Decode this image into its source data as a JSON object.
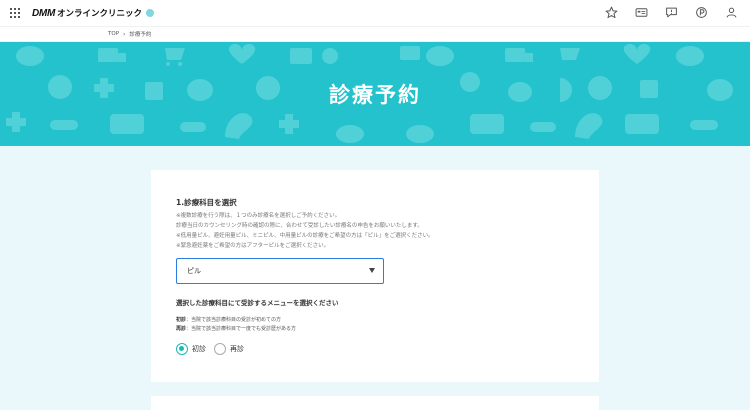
{
  "header": {
    "logo_brand": "DMM",
    "logo_text": "オンラインクリニック",
    "icons": [
      "star-icon",
      "id-card-icon",
      "chat-icon",
      "point-icon",
      "user-icon"
    ]
  },
  "breadcrumb": {
    "items": [
      "TOP",
      "診療予約"
    ],
    "separator": "›"
  },
  "hero": {
    "title": "診療予約",
    "background": "#24c2cc"
  },
  "form": {
    "section_heading": "1.診療科目を選択",
    "notes": [
      "※複数診療を行う際は、１つのみ診療名を選択しご予約ください。",
      "診療当日のカウンセリング時の確認の際に、合わせて受診したい診療名の申告をお願いいたします。",
      "※低用量ピル、避妊用量ピル、ミニピル、中用量ピルの診療をご希望の方は「ピル」をご選択ください。",
      "※緊急避妊薬をご希望の方はアフターピルをご選択ください。"
    ],
    "select_value": "ピル",
    "menu_heading": "選択した診療科目にて受診するメニューを選択ください",
    "descriptions": [
      {
        "term": "初診",
        "text": "：当院で該当診療科目の受診が初めての方"
      },
      {
        "term": "再診",
        "text": "：当院で該当診療科目で一度でも受診歴がある方"
      }
    ],
    "radio_options": [
      {
        "label": "初診",
        "checked": true
      },
      {
        "label": "再診",
        "checked": false
      }
    ],
    "accent_color": "#1fb8b6",
    "select_border_color": "#2a7de1"
  }
}
